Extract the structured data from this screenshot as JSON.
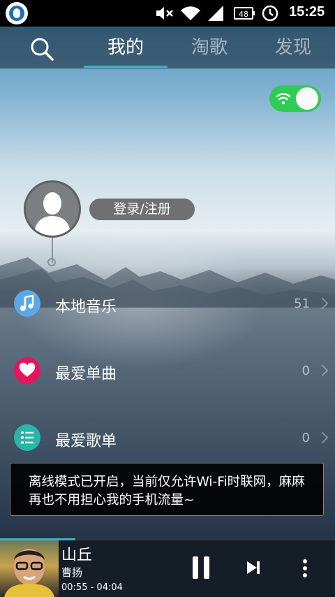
{
  "status_bar": {
    "app_icon": "app-logo-icon",
    "icons": [
      "mute-icon",
      "wifi-icon",
      "signal-icon",
      "battery-icon",
      "alarm-clock-icon"
    ],
    "battery_level": "48",
    "time": "15:25"
  },
  "nav": {
    "search_icon": "search-icon",
    "tabs": [
      {
        "label": "我的",
        "active": true
      },
      {
        "label": "淘歌",
        "active": false
      },
      {
        "label": "发现",
        "active": false
      }
    ]
  },
  "wifi_toggle": {
    "icon": "wifi-icon",
    "on": true,
    "color": "#2ecc55"
  },
  "profile": {
    "avatar_icon": "default-avatar-icon",
    "login_label": "登录/注册"
  },
  "menu": [
    {
      "label": "本地音乐",
      "count": "51",
      "icon": "music-note-icon",
      "color": "#5aa9e6"
    },
    {
      "label": "最爱单曲",
      "count": "0",
      "icon": "heart-icon",
      "color": "#e8145a"
    },
    {
      "label": "最爱歌单",
      "count": "0",
      "icon": "list-icon",
      "color": "#2bb5a8"
    }
  ],
  "toast": {
    "message": "离线模式已开启，当前仅允许Wi-Fi时联网，麻麻再也不用担心我的手机流量~"
  },
  "player": {
    "title": "山丘",
    "artist": "曹扬",
    "time": "00:55 - 04:04",
    "progress": 0.225,
    "accent": "#3fb0c8",
    "controls": [
      "pause-icon",
      "next-icon",
      "more-icon"
    ]
  }
}
